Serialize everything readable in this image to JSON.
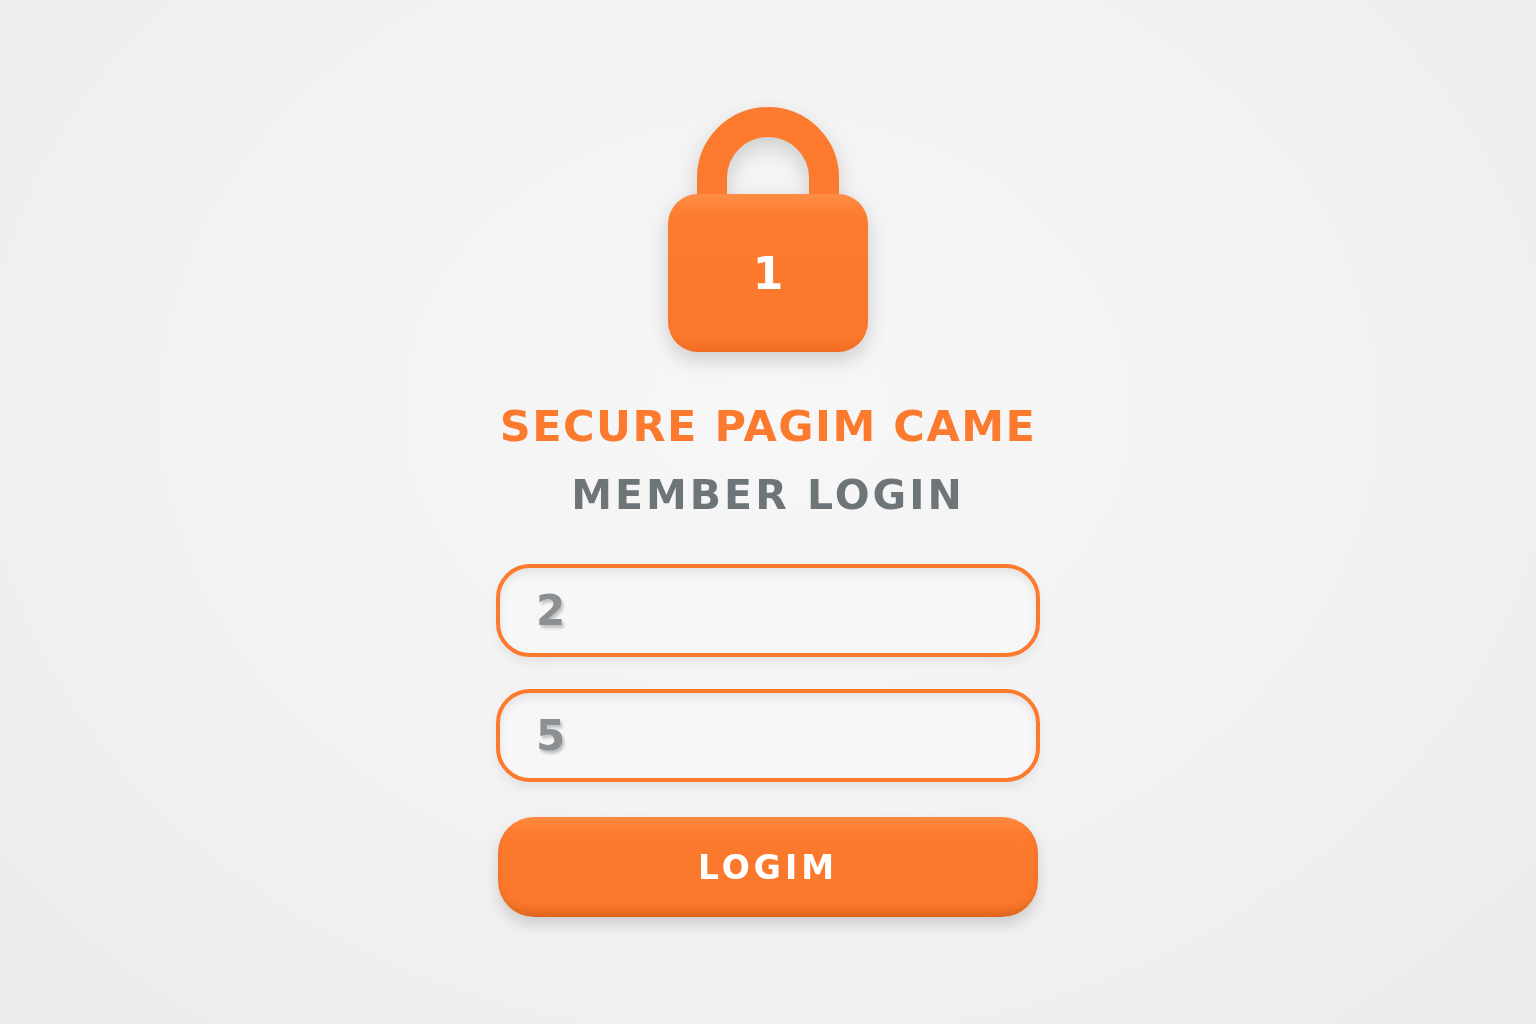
{
  "padlock": {
    "label": "1"
  },
  "title": "SECURE PAGIM CAME",
  "subtitle": "MEMBER LOGIN",
  "fields": [
    {
      "value": "2"
    },
    {
      "value": "5"
    }
  ],
  "button": {
    "label": "LOGIM"
  }
}
